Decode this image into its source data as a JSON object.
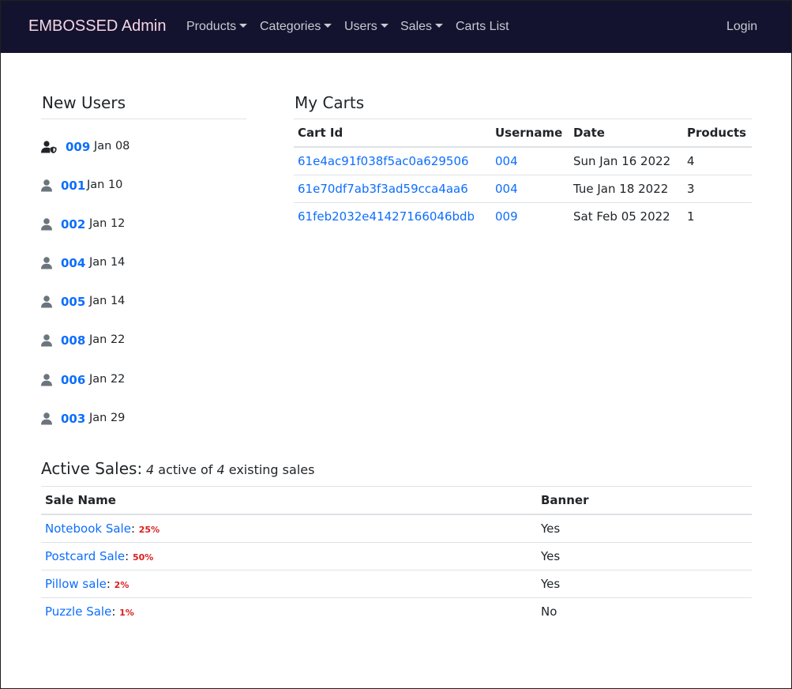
{
  "navbar": {
    "brand": "EMBOSSED Admin",
    "items": [
      {
        "label": "Products"
      },
      {
        "label": "Categories"
      },
      {
        "label": "Users"
      },
      {
        "label": "Sales"
      },
      {
        "label": "Carts List"
      }
    ],
    "login": "Login"
  },
  "new_users": {
    "title": "New Users",
    "users": [
      {
        "id": "009",
        "date": "Jan 08",
        "icon": "user-shield-icon"
      },
      {
        "id": "001",
        "date": "Jan 10",
        "icon": "user-icon"
      },
      {
        "id": "002",
        "date": "Jan 12",
        "icon": "user-icon"
      },
      {
        "id": "004",
        "date": "Jan 14",
        "icon": "user-icon"
      },
      {
        "id": "005",
        "date": "Jan 14",
        "icon": "user-icon"
      },
      {
        "id": "008",
        "date": "Jan 22",
        "icon": "user-icon"
      },
      {
        "id": "006",
        "date": "Jan 22",
        "icon": "user-icon"
      },
      {
        "id": "003",
        "date": "Jan 29",
        "icon": "user-icon"
      }
    ]
  },
  "my_carts": {
    "title": "My Carts",
    "columns": [
      "Cart Id",
      "Username",
      "Date",
      "Products"
    ],
    "rows": [
      {
        "cart_id": "61e4ac91f038f5ac0a629506",
        "username": "004",
        "date": "Sun Jan 16 2022",
        "products": "4"
      },
      {
        "cart_id": "61e70df7ab3f3ad59cca4aa6",
        "username": "004",
        "date": "Tue Jan 18 2022",
        "products": "3"
      },
      {
        "cart_id": "61feb2032e41427166046bdb",
        "username": "009",
        "date": "Sat Feb 05 2022",
        "products": "1"
      }
    ]
  },
  "active_sales": {
    "title": "Active Sales:",
    "active_count": "4",
    "active_text": " active of ",
    "total_count": "4",
    "total_text": " existing sales",
    "columns": [
      "Sale Name",
      "Banner"
    ],
    "rows": [
      {
        "name": "Notebook Sale",
        "percent": "25%",
        "banner": "Yes"
      },
      {
        "name": "Postcard Sale",
        "percent": "50%",
        "banner": "Yes"
      },
      {
        "name": "Pillow sale",
        "percent": "2%",
        "banner": "Yes"
      },
      {
        "name": "Puzzle Sale",
        "percent": "1%",
        "banner": "No"
      }
    ]
  },
  "colors": {
    "navbar_bg": "#14132f",
    "brand": "#f5d6e4",
    "link": "#0d6efd",
    "percent": "#dc1d1d",
    "icon": "#6c757d"
  }
}
